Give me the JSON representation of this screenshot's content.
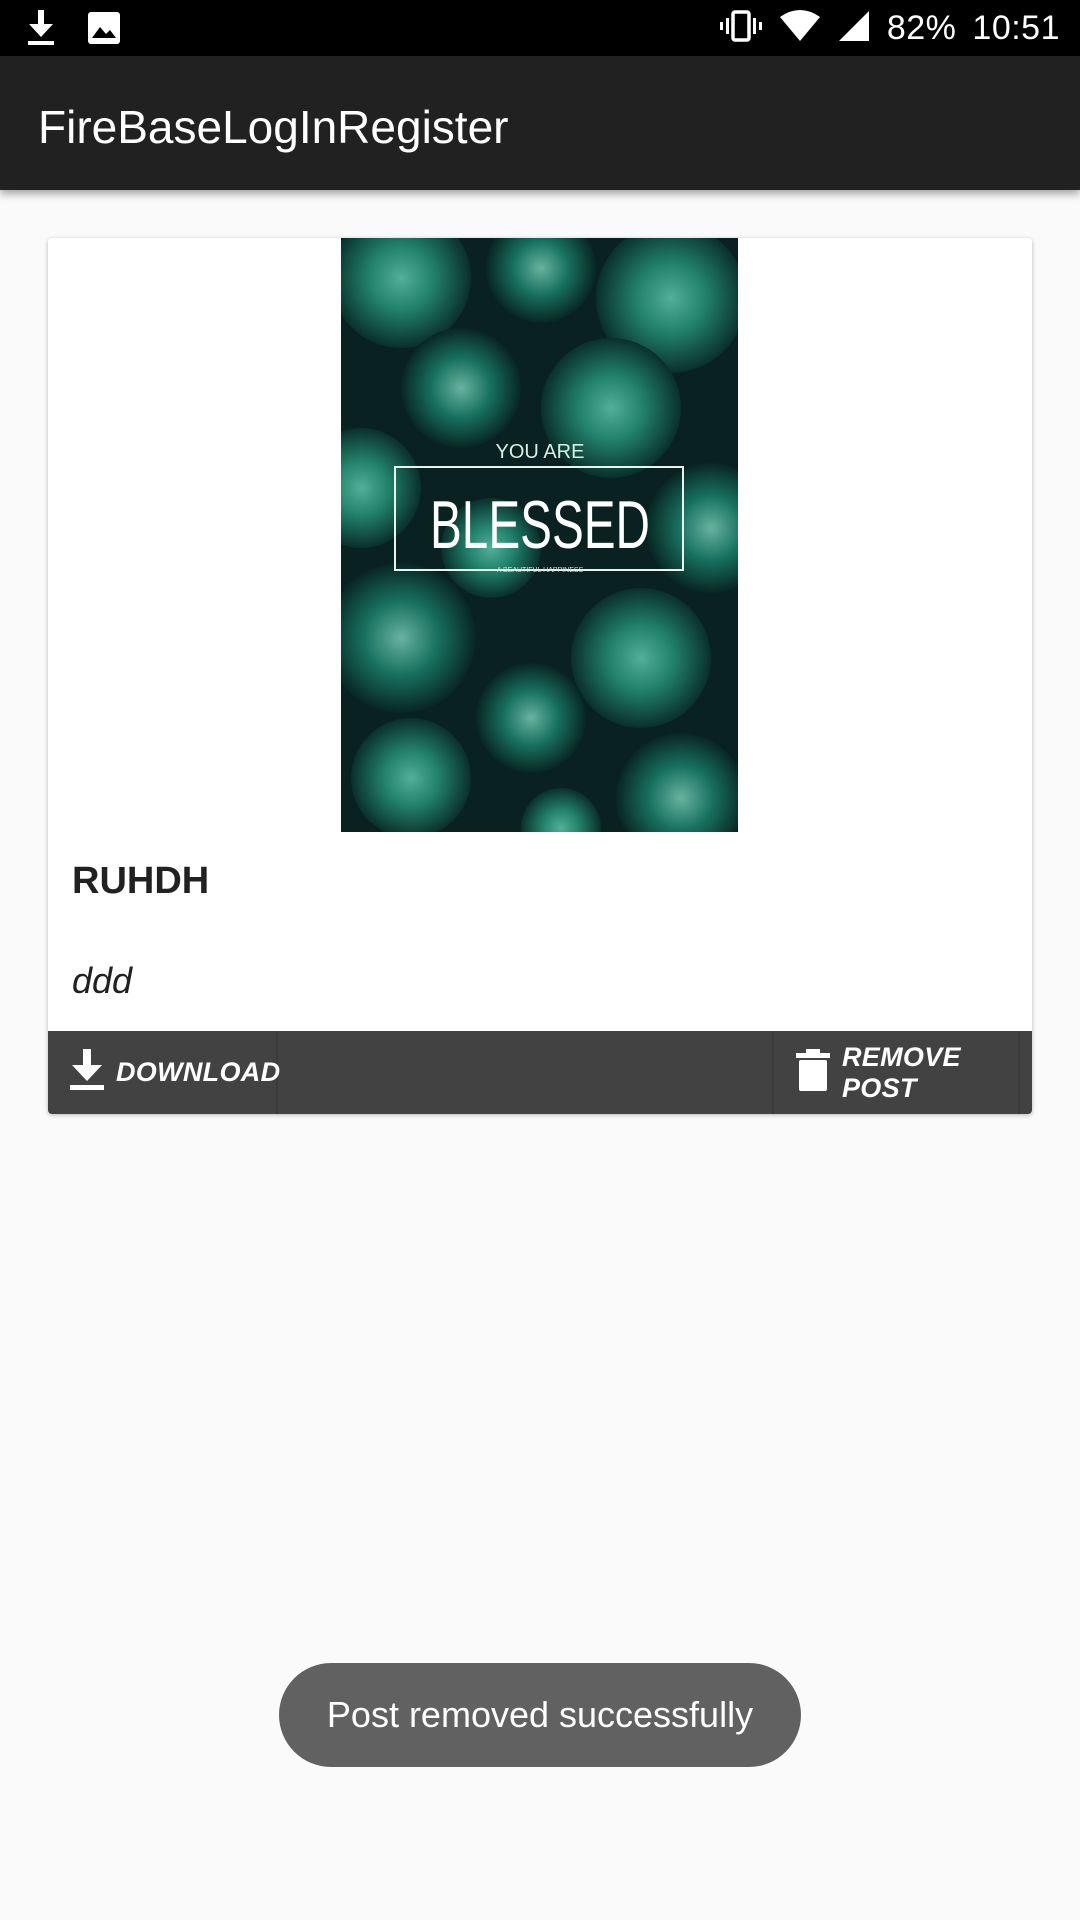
{
  "status_bar": {
    "battery_percent": "82%",
    "time": "10:51",
    "icons": [
      "download-icon",
      "image-icon",
      "vibrate-icon",
      "wifi-icon",
      "signal-icon"
    ]
  },
  "app_bar": {
    "title": "FireBaseLogInRegister",
    "background_color": "#212121"
  },
  "post": {
    "image_icon": "succulent-photo",
    "image_text_small": "YOU ARE",
    "image_text_large": "BLESSED",
    "image_text_caption": "A BEAUTIFUL HAPPINESS",
    "title": "RUHDH",
    "description": "ddd",
    "actions": {
      "download_label": "DOWNLOAD",
      "remove_label": "REMOVE POST"
    },
    "action_bar_color": "#424242"
  },
  "toast": {
    "message": "Post removed successfully"
  }
}
